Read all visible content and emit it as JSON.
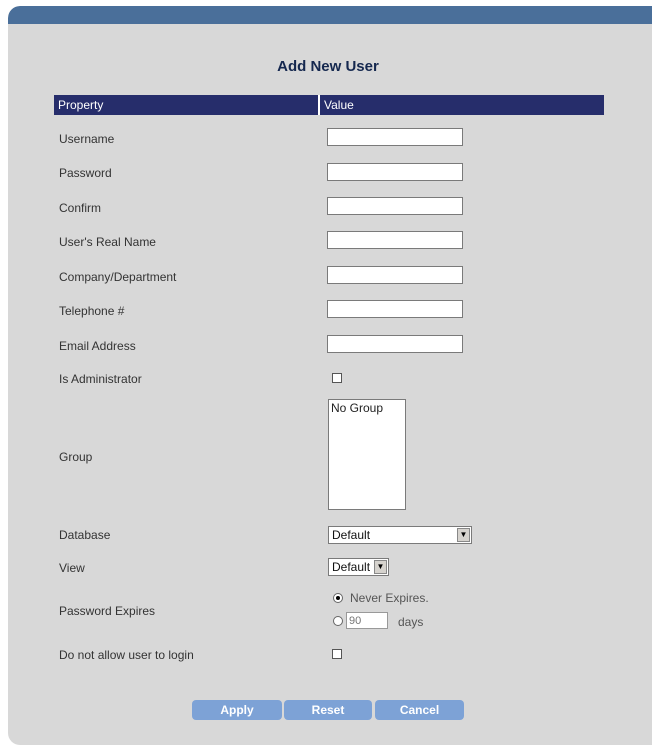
{
  "form": {
    "title": "Add New User",
    "columns": {
      "property": "Property",
      "value": "Value"
    },
    "fields": {
      "username": {
        "label": "Username",
        "value": ""
      },
      "password": {
        "label": "Password",
        "value": ""
      },
      "confirm": {
        "label": "Confirm",
        "value": ""
      },
      "real_name": {
        "label": "User's Real Name",
        "value": ""
      },
      "company": {
        "label": "Company/Department",
        "value": ""
      },
      "telephone": {
        "label": "Telephone #",
        "value": ""
      },
      "email": {
        "label": "Email Address",
        "value": ""
      },
      "is_admin": {
        "label": "Is Administrator",
        "checked": false
      },
      "group": {
        "label": "Group",
        "options": [
          "No Group"
        ]
      },
      "database": {
        "label": "Database",
        "selected": "Default"
      },
      "view": {
        "label": "View",
        "selected": "Default"
      },
      "password_expires": {
        "label": "Password Expires",
        "never_label": "Never Expires.",
        "never_selected": true,
        "days_placeholder": "90",
        "days_label": "days"
      },
      "disallow_login": {
        "label": "Do not allow user to login",
        "checked": false
      }
    },
    "buttons": {
      "apply": "Apply",
      "reset": "Reset",
      "cancel": "Cancel"
    }
  },
  "colors": {
    "header_bg": "#262d6b",
    "title": "#15284f",
    "button_bg": "#7da2d6",
    "panel_bg": "#d8d8d8",
    "topbar": "#4a6f9a"
  },
  "icons": {
    "dropdown_arrow": "chevron-down-icon"
  }
}
